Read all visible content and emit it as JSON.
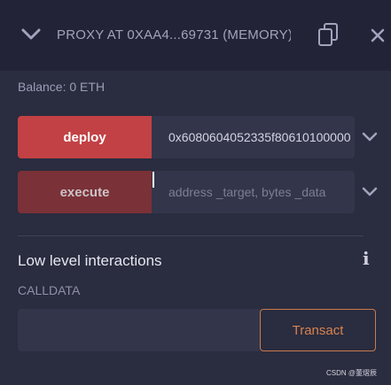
{
  "header": {
    "title": "PROXY AT 0XAA4...69731 (MEMORY)",
    "icons": {
      "collapse": "chevron-down-icon",
      "copy": "copy-icon",
      "close": "close-icon"
    }
  },
  "balance": "Balance: 0 ETH",
  "functions": [
    {
      "button_label": "deploy",
      "input_value": "0x6080604052335f80610100000",
      "input_placeholder": ""
    },
    {
      "button_label": "execute",
      "input_value": "",
      "input_placeholder": "address _target, bytes _data"
    }
  ],
  "low_level": {
    "title": "Low level interactions",
    "info_glyph": "i",
    "calldata_label": "CALLDATA",
    "calldata_value": "",
    "transact_label": "Transact"
  },
  "watermark": "CSDN @董熠辰",
  "colors": {
    "deploy_button": "#c24144",
    "execute_button": "#7a3137",
    "transact_border": "#c97b4e"
  }
}
